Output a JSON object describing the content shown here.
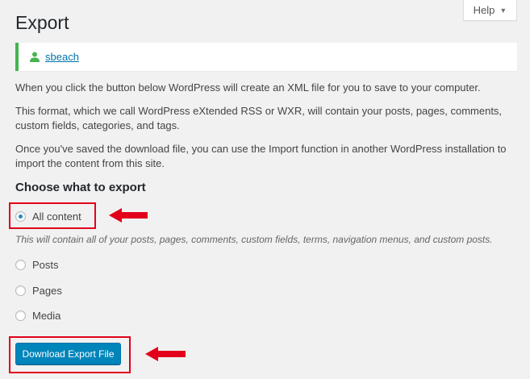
{
  "header": {
    "help_label": "Help",
    "title": "Export"
  },
  "notice": {
    "username": "sbeach",
    "accent_color": "#46b450",
    "icon": "user-icon"
  },
  "intro": {
    "p1": "When you click the button below WordPress will create an XML file for you to save to your computer.",
    "p2": "This format, which we call WordPress eXtended RSS or WXR, will contain your posts, pages, comments, custom fields, categories, and tags.",
    "p3": "Once you've saved the download file, you can use the Import function in another WordPress installation to import the content from this site."
  },
  "export_options": {
    "heading": "Choose what to export",
    "selected": "All content",
    "all_content_label": "All content",
    "all_content_desc": "This will contain all of your posts, pages, comments, custom fields, terms, navigation menus, and custom posts.",
    "posts_label": "Posts",
    "pages_label": "Pages",
    "media_label": "Media"
  },
  "actions": {
    "download_label": "Download Export File",
    "button_color": "#0085ba"
  },
  "annotations": {
    "highlight_color": "#e2001a"
  }
}
